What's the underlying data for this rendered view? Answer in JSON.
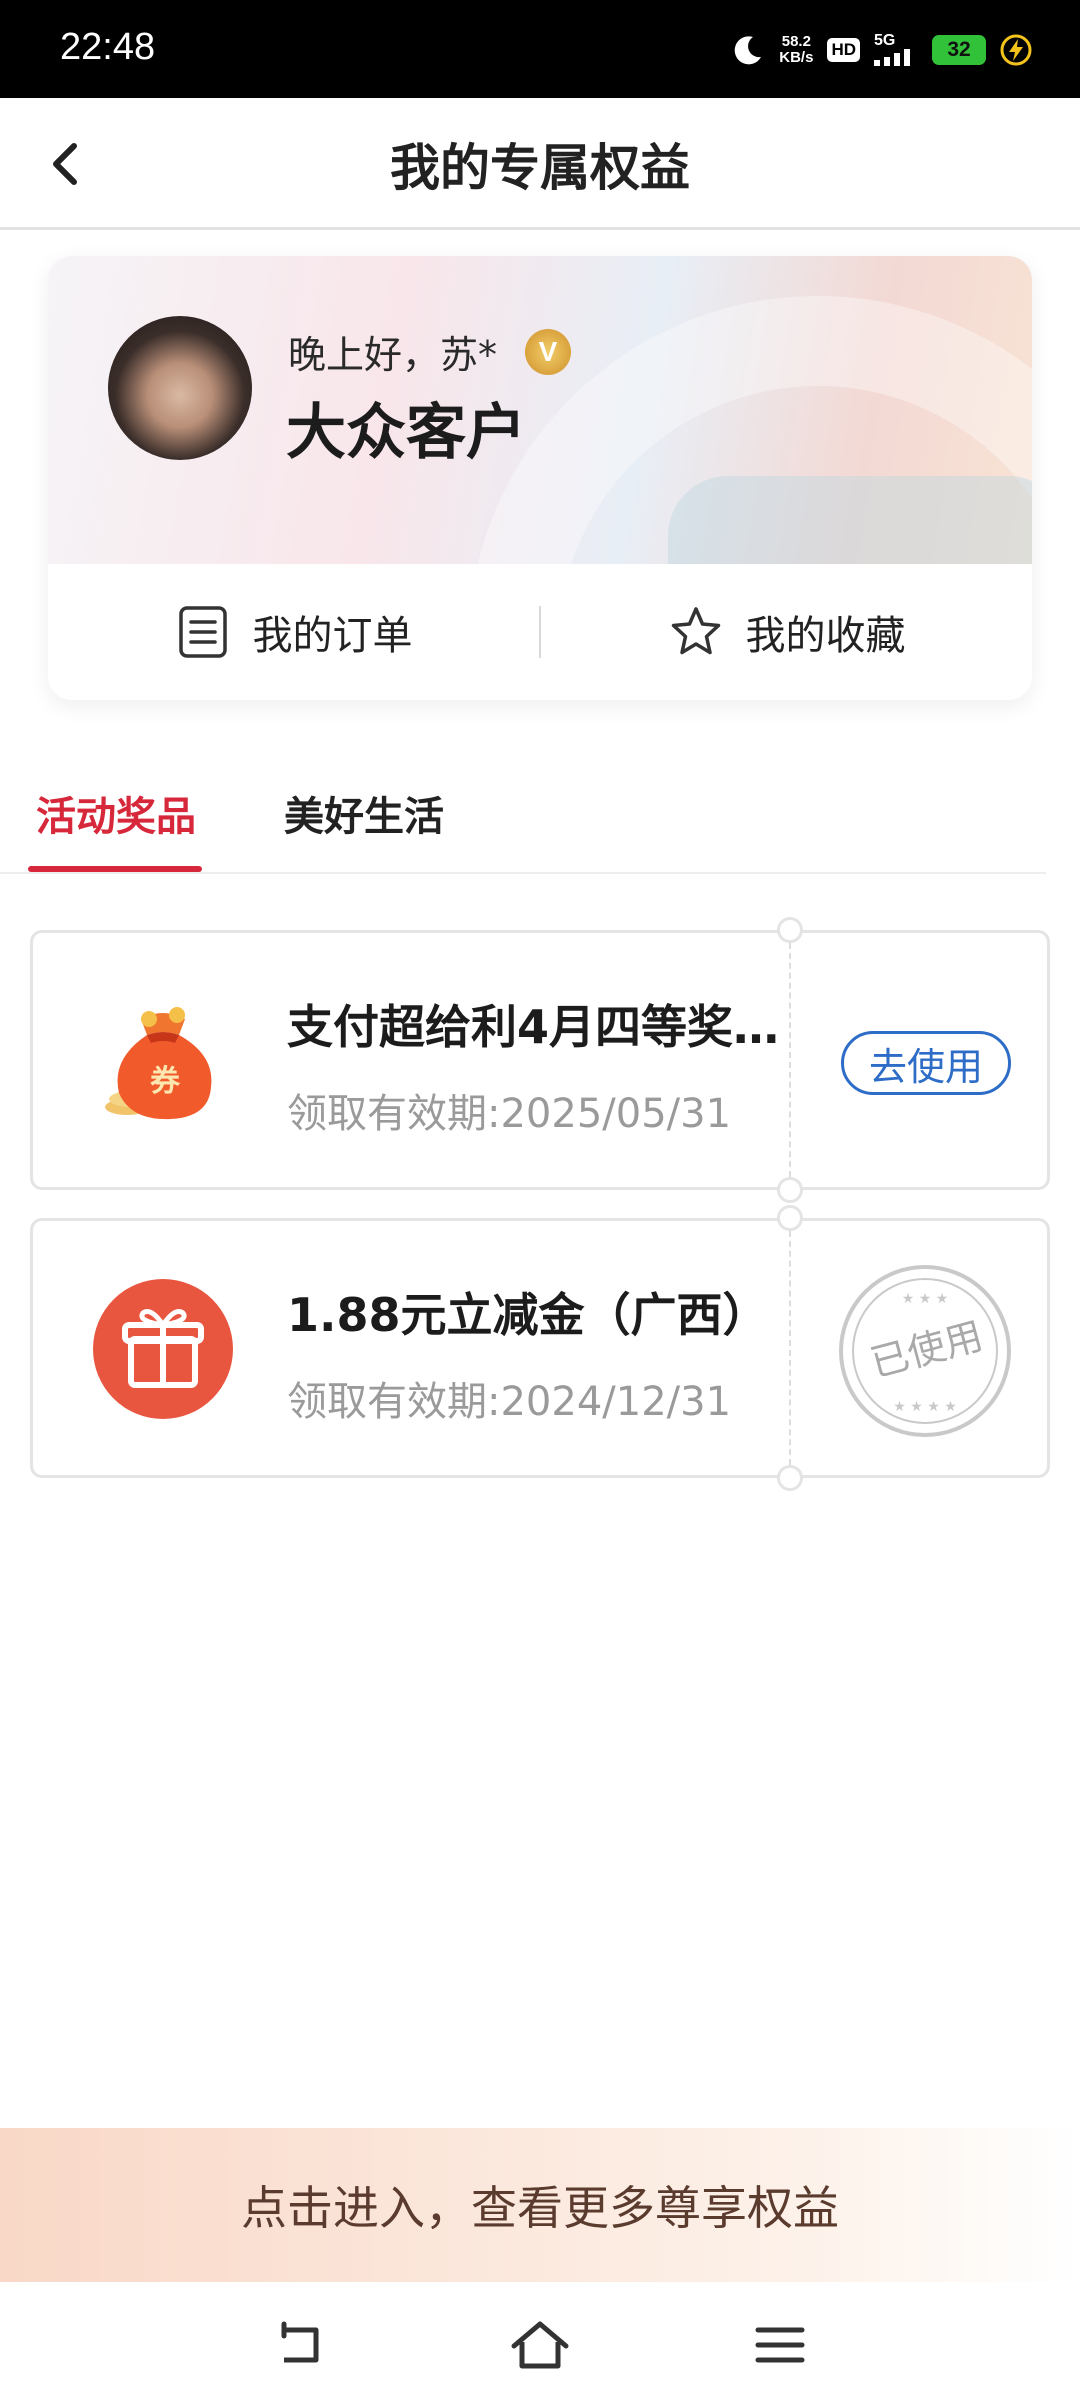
{
  "status_bar": {
    "time": "22:48",
    "net_speed_value": "58.2",
    "net_speed_unit": "KB/s",
    "hd_label": "HD",
    "network_label": "5G",
    "battery_level": "32",
    "icons": [
      "moon-icon",
      "signal-icon",
      "charging-icon"
    ]
  },
  "header": {
    "title": "我的专属权益",
    "back_icon": "chevron-left-icon"
  },
  "profile": {
    "greeting": "晚上好，苏*",
    "vip_badge": "V",
    "level": "大众客户",
    "quick_links": [
      {
        "label": "我的订单",
        "icon": "order-list-icon"
      },
      {
        "label": "我的收藏",
        "icon": "star-icon"
      }
    ]
  },
  "tabs": [
    {
      "label": "活动奖品",
      "active": true
    },
    {
      "label": "美好生活",
      "active": false
    }
  ],
  "rewards": [
    {
      "icon": "coupon-bag-icon",
      "icon_text": "券",
      "name": "支付超给利4月四等奖…",
      "validity": "领取有效期:2025/05/31",
      "action": "去使用",
      "status": "usable"
    },
    {
      "icon": "gift-box-icon",
      "name": "1.88元立减金（广西）",
      "validity": "领取有效期:2024/12/31",
      "stamp": "已使用",
      "status": "used"
    }
  ],
  "banner": {
    "text": "点击进入，查看更多尊享权益"
  },
  "nav_bar": {
    "icons": [
      "back-nav-icon",
      "home-nav-icon",
      "menu-nav-icon"
    ]
  },
  "colors": {
    "accent": "#d6283a",
    "link_blue": "#2d6cc7",
    "muted_text": "#9a9a9a",
    "battery_green": "#32c23a"
  }
}
